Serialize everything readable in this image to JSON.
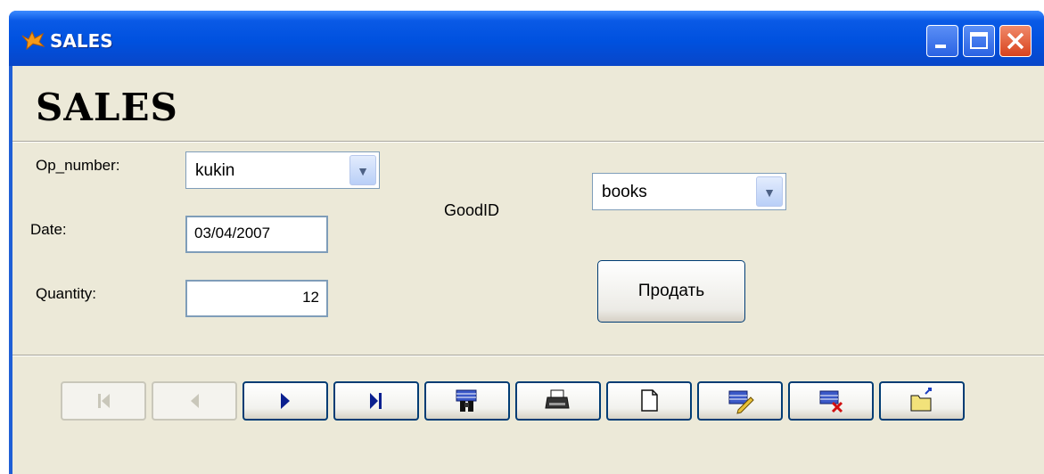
{
  "window": {
    "title": "SALES"
  },
  "form": {
    "heading": "SALES",
    "op_number": {
      "label": "Op_number:",
      "value": "kukin"
    },
    "date": {
      "label": "Date:",
      "value": "03/04/2007"
    },
    "quantity": {
      "label": "Quantity:",
      "value": "12"
    },
    "good_id": {
      "label": "GoodID",
      "value": "books"
    },
    "sell_button": "Продать"
  },
  "toolbar": {
    "buttons": [
      {
        "name": "first",
        "icon": "first-record-icon",
        "enabled": false
      },
      {
        "name": "previous",
        "icon": "previous-record-icon",
        "enabled": false
      },
      {
        "name": "next",
        "icon": "next-record-icon",
        "enabled": true
      },
      {
        "name": "last",
        "icon": "last-record-icon",
        "enabled": true
      },
      {
        "name": "find",
        "icon": "find-binoculars-icon",
        "enabled": true
      },
      {
        "name": "print",
        "icon": "printer-icon",
        "enabled": true
      },
      {
        "name": "new",
        "icon": "new-document-icon",
        "enabled": true
      },
      {
        "name": "edit",
        "icon": "edit-record-icon",
        "enabled": true
      },
      {
        "name": "delete",
        "icon": "delete-record-icon",
        "enabled": true
      },
      {
        "name": "exit",
        "icon": "exit-folder-icon",
        "enabled": true
      }
    ]
  },
  "colors": {
    "titlebar": "#0051df",
    "client": "#ece9d8",
    "disabled": "#c9c7ba"
  }
}
